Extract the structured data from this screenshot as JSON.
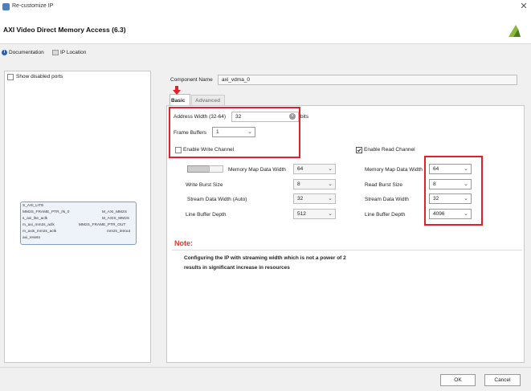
{
  "window": {
    "title": "Re-customize IP"
  },
  "header": {
    "ip_title": "AXI Video Direct Memory Access (6.3)"
  },
  "links": {
    "documentation": "Documentation",
    "ip_location": "IP Location"
  },
  "left": {
    "show_disabled_ports": "Show disabled ports",
    "block": {
      "left_ports": [
        "S_AXI_LITE",
        "MM2S_FRAME_PTR_IN_0",
        "s_axi_lite_aclk",
        "m_axi_mm2s_aclk",
        "m_axis_mm2s_aclk",
        "axi_resetn"
      ],
      "right_ports": [
        "M_AXI_MM2S",
        "M_AXIS_MM2S",
        "MM2S_FRAME_PTR_OUT",
        "mm2s_introut"
      ]
    }
  },
  "component": {
    "label": "Component Name",
    "value": "axi_vdma_0"
  },
  "tabs": {
    "basic": "Basic",
    "advanced": "Advanced"
  },
  "basic": {
    "address_width_label": "Address Width (32-64)",
    "address_width_value": "32",
    "bits_label": "bits",
    "frame_buffers_label": "Frame Buffers",
    "frame_buffers_value": "1",
    "enable_write_label": "Enable Write Channel",
    "enable_read_label": "Enable Read Channel",
    "write": {
      "mm_data_width_label": "Memory Map Data Width",
      "mm_data_width_value": "64",
      "burst_label": "Write Burst Size",
      "burst_value": "8",
      "stream_label": "Stream Data Width (Auto)",
      "stream_value": "32",
      "line_buffer_label": "Line Buffer Depth",
      "line_buffer_value": "512"
    },
    "read": {
      "mm_data_width_label": "Memory Map Data Width",
      "mm_data_width_value": "64",
      "burst_label": "Read Burst Size",
      "burst_value": "8",
      "stream_label": "Stream Data Width",
      "stream_value": "32",
      "line_buffer_label": "Line Buffer Depth",
      "line_buffer_value": "4096"
    },
    "note_title": "Note:",
    "note_line1": "Configuring the IP with streaming width which is not a power of 2",
    "note_line2": "results in significant increase in resources"
  },
  "buttons": {
    "ok": "OK",
    "cancel": "Cancel"
  },
  "colors": {
    "annotation_red": "#e0202a",
    "note_red": "#e33a2a"
  }
}
